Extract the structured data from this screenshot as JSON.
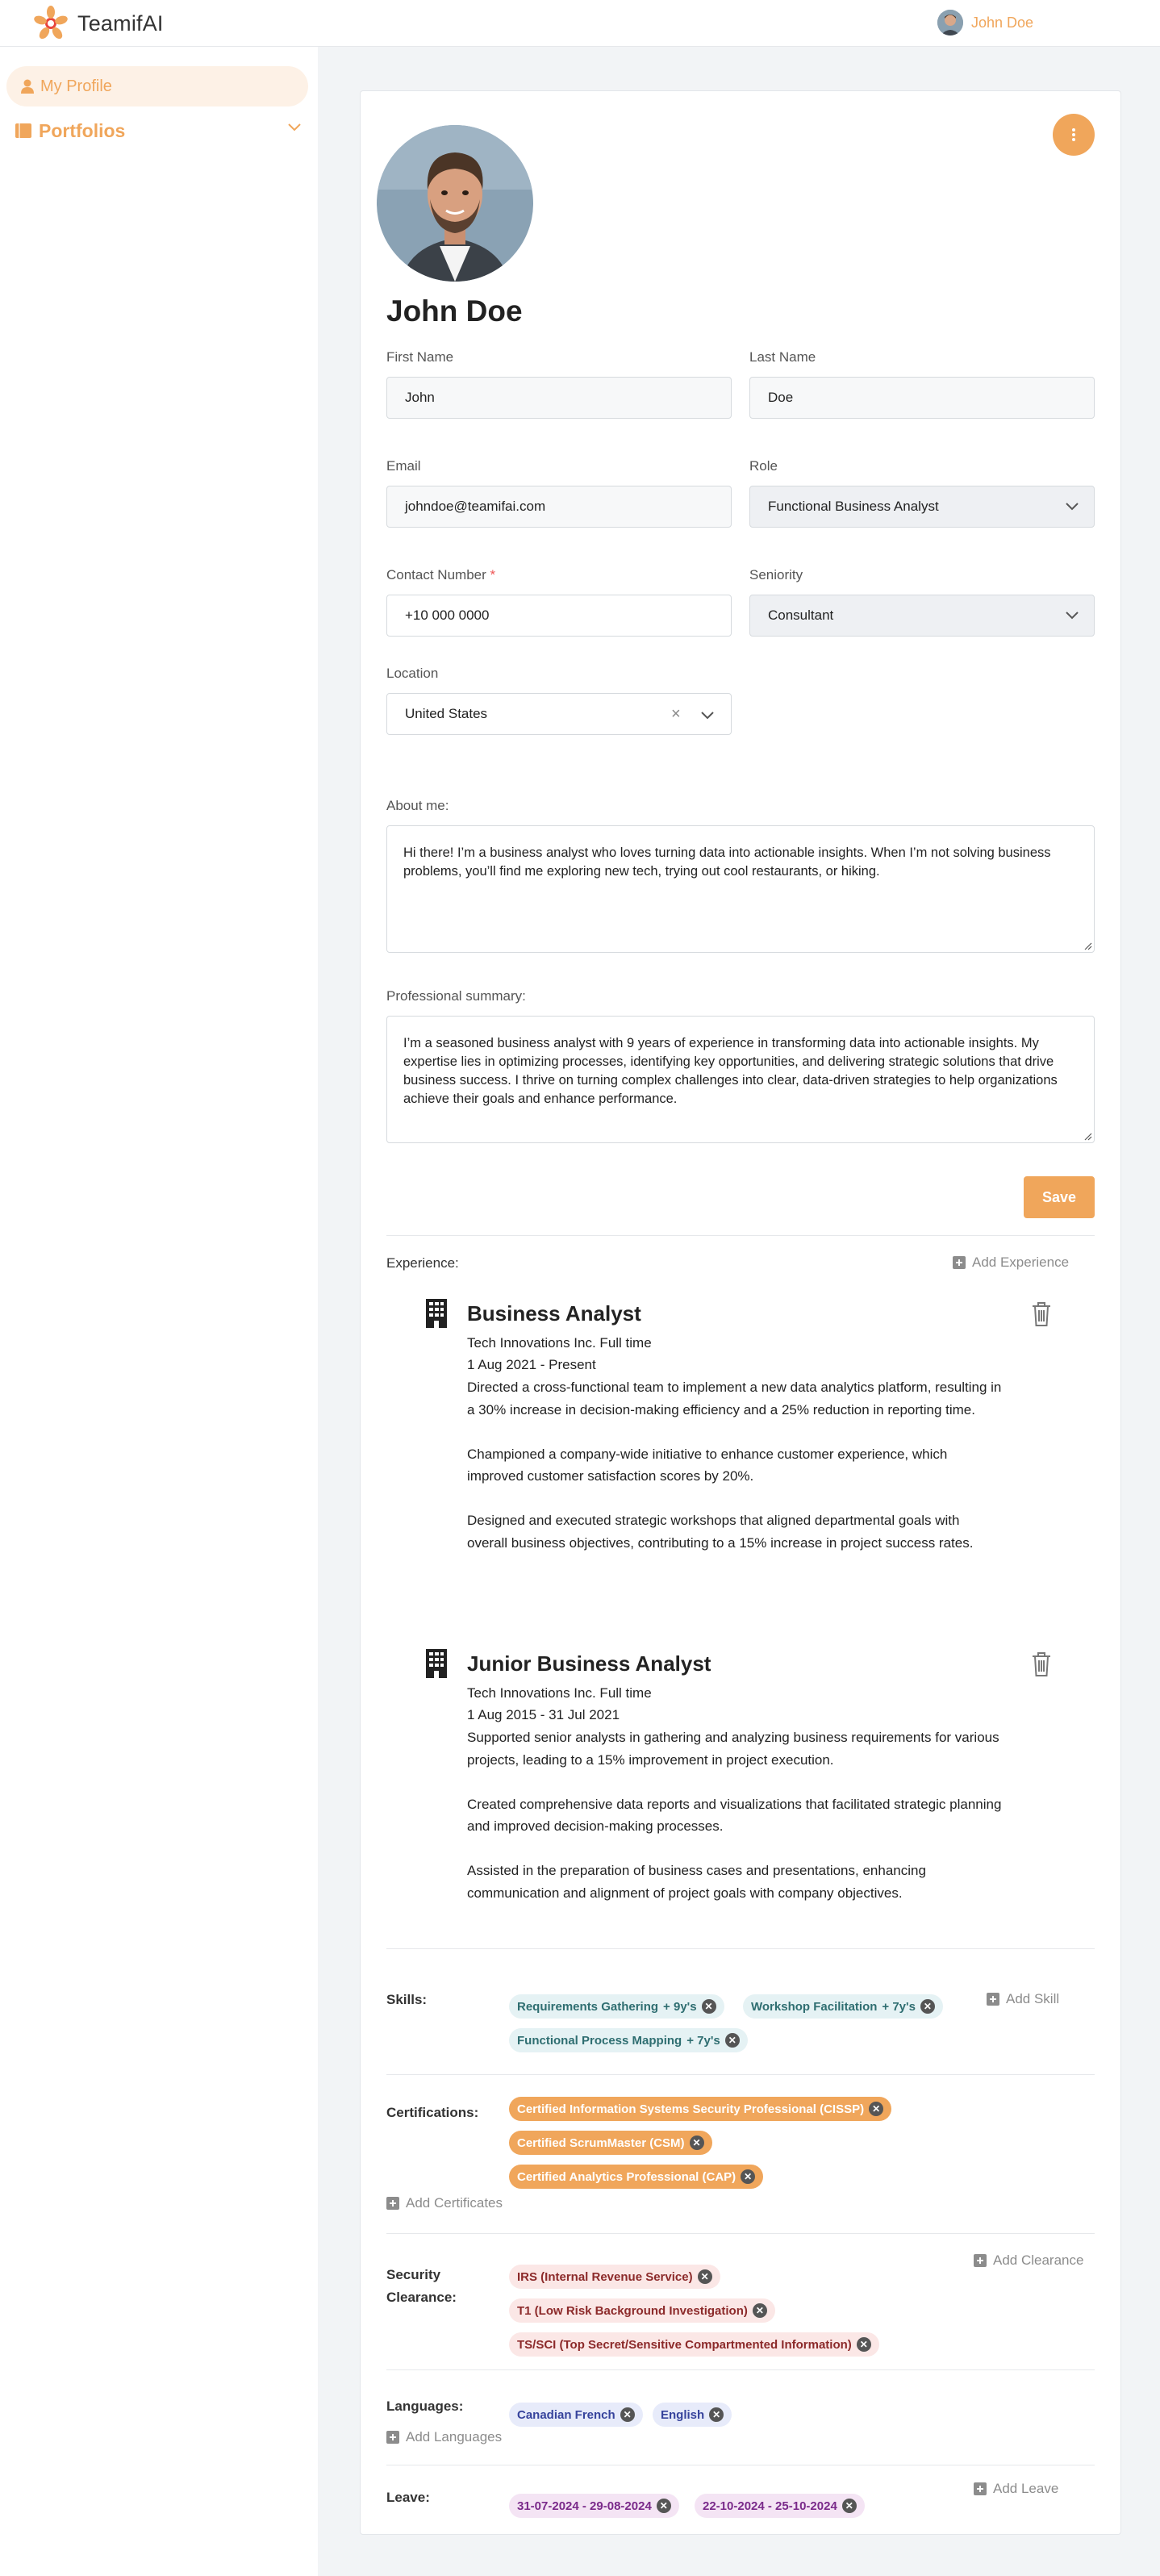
{
  "app": {
    "name": "TeamifAI"
  },
  "header": {
    "user_name": "John  Doe"
  },
  "sidebar": {
    "items": [
      {
        "label": "My Profile",
        "icon": "user-icon"
      },
      {
        "label": "Portfolios",
        "icon": "folder-icon"
      }
    ]
  },
  "profile": {
    "display_name": "John Doe",
    "fields": {
      "first_name": {
        "label": "First Name",
        "value": "John"
      },
      "last_name": {
        "label": "Last Name",
        "value": "Doe"
      },
      "email": {
        "label": "Email",
        "value": "johndoe@teamifai.com"
      },
      "role": {
        "label": "Role",
        "value": "Functional Business Analyst"
      },
      "contact": {
        "label": "Contact Number",
        "required_mark": "*",
        "value": "+10 000 0000"
      },
      "seniority": {
        "label": "Seniority",
        "value": "Consultant"
      },
      "location": {
        "label": "Location",
        "value": "United States",
        "clear": "×"
      }
    },
    "about": {
      "label": "About me:",
      "value": "Hi there! I’m a business analyst who loves turning data into actionable insights. When I’m not solving business problems, you’ll find me exploring new tech, trying out cool restaurants, or hiking."
    },
    "summary": {
      "label": "Professional summary:",
      "value": "I’m a seasoned business analyst with 9 years of experience in transforming data into actionable insights. My expertise lies in optimizing processes, identifying key opportunities, and delivering strategic solutions that drive business success. I thrive on turning complex challenges into clear, data-driven strategies to help organizations achieve their goals and enhance performance."
    },
    "save_label": "Save"
  },
  "experience": {
    "label": "Experience:",
    "add_label": "Add Experience",
    "items": [
      {
        "title": "Business Analyst",
        "company": "Tech Innovations Inc. Full time",
        "dates": "1 Aug 2021 - Present",
        "bullets": [
          "Directed a cross-functional team to implement a new data analytics platform, resulting in a 30% increase in decision-making efficiency and a 25% reduction in reporting time.",
          "Championed a company-wide initiative to enhance customer experience, which improved customer satisfaction scores by 20%.",
          "Designed and executed strategic workshops that aligned departmental goals with overall business objectives, contributing to a 15% increase in project success rates."
        ]
      },
      {
        "title": "Junior Business Analyst",
        "company": "Tech Innovations Inc. Full time",
        "dates": "1 Aug 2015 - 31 Jul 2021",
        "bullets": [
          "Supported senior analysts in gathering and analyzing business requirements for various projects, leading to a 15% improvement in project execution.",
          "Created comprehensive data reports and visualizations that facilitated strategic planning and improved decision-making processes.",
          "Assisted in the preparation of business cases and presentations, enhancing communication and alignment of project goals with company objectives."
        ]
      }
    ]
  },
  "skills": {
    "label": "Skills:",
    "add_label": "Add Skill",
    "items": [
      {
        "name": "Requirements Gathering",
        "years": "+ 9y's"
      },
      {
        "name": "Workshop Facilitation",
        "years": "+ 7y's"
      },
      {
        "name": "Functional Process Mapping",
        "years": "+ 7y's"
      }
    ]
  },
  "certifications": {
    "label": "Certifications:",
    "add_label": "Add Certificates",
    "items": [
      "Certified Information Systems Security Professional (CISSP)",
      "Certified ScrumMaster (CSM)",
      "Certified Analytics Professional (CAP)"
    ]
  },
  "security": {
    "label_line1": "Security",
    "label_line2": "Clearance:",
    "add_label": "Add Clearance",
    "items": [
      "IRS (Internal Revenue Service)",
      "T1 (Low Risk Background Investigation)",
      "TS/SCI (Top Secret/Sensitive Compartmented Information)"
    ]
  },
  "languages": {
    "label": "Languages:",
    "add_label": "Add Languages",
    "items": [
      "Canadian French",
      "English"
    ]
  },
  "leave": {
    "label": "Leave:",
    "add_label": "Add Leave",
    "items": [
      "31-07-2024 - 29-08-2024",
      "22-10-2024 - 25-10-2024"
    ]
  },
  "colors": {
    "accent": "#f0a65b",
    "skill_bg": "#e5f2f4",
    "security_bg": "#fbe7e6",
    "language_bg": "#e7ebfa",
    "leave_bg": "#f4e4f4"
  }
}
